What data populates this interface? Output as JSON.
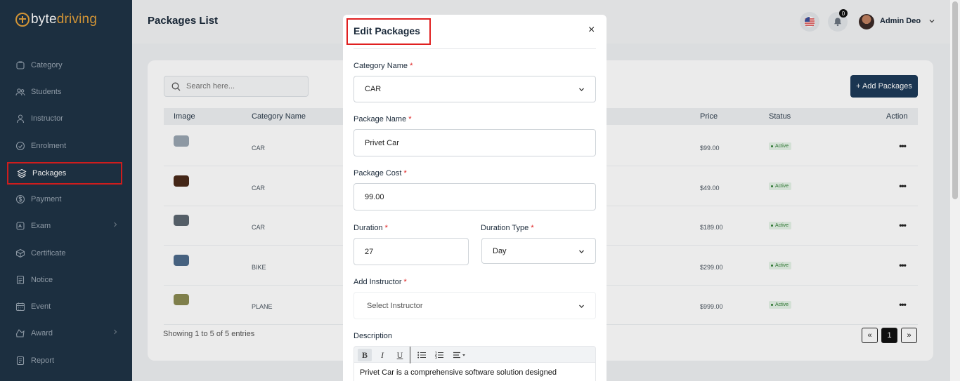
{
  "brand": {
    "part1": "byte",
    "part2": "driving",
    "accent": "#e3a13b"
  },
  "sidebar": {
    "items": [
      {
        "label": "Category",
        "icon": "category-icon",
        "top": 0
      },
      {
        "label": "Students",
        "icon": "students-icon"
      },
      {
        "label": "Instructor",
        "icon": "instructor-icon"
      },
      {
        "label": "Enrolment",
        "icon": "enrolment-icon"
      },
      {
        "label": "Packages",
        "icon": "packages-icon",
        "active": true
      },
      {
        "label": "Payment",
        "icon": "payment-icon"
      },
      {
        "label": "Exam",
        "icon": "exam-icon",
        "has_children": true
      },
      {
        "label": "Certificate",
        "icon": "certificate-icon"
      },
      {
        "label": "Notice",
        "icon": "notice-icon"
      },
      {
        "label": "Event",
        "icon": "event-icon"
      },
      {
        "label": "Award",
        "icon": "award-icon",
        "has_children": true
      },
      {
        "label": "Report",
        "icon": "report-icon"
      }
    ]
  },
  "header": {
    "title": "Packages List",
    "notifications_count": "0",
    "user_name": "Admin Deo",
    "flag_icon": "us-flag-icon",
    "bell_icon": "bell-icon"
  },
  "list": {
    "search_placeholder": "Search here...",
    "add_button": "+ Add Packages",
    "columns": [
      "Image",
      "Category Name",
      "Price",
      "Status",
      "Action"
    ],
    "rows": [
      {
        "category": "CAR",
        "price": "$99.00",
        "status": "Active",
        "thumb": "#9aa5b1"
      },
      {
        "category": "CAR",
        "price": "$49.00",
        "status": "Active",
        "thumb": "#4a2a1a"
      },
      {
        "category": "CAR",
        "price": "$189.00",
        "status": "Active",
        "thumb": "#5c6670"
      },
      {
        "category": "BIKE",
        "price": "$299.00",
        "status": "Active",
        "thumb": "#4d6a8a"
      },
      {
        "category": "PLANE",
        "price": "$999.00",
        "status": "Active",
        "thumb": "#8a8a52"
      }
    ],
    "action_label": "•••",
    "entries_text": "Showing 1 to 5 of 5 entries",
    "pagination": {
      "prev": "«",
      "current": "1",
      "next": "»"
    }
  },
  "modal": {
    "title": "Edit Packages",
    "close": "×",
    "category_label": "Category Name",
    "category_value": "CAR",
    "package_name_label": "Package Name",
    "package_name_value": "Privet Car",
    "package_cost_label": "Package Cost",
    "package_cost_value": "99.00",
    "duration_label": "Duration",
    "duration_value": "27",
    "duration_type_label": "Duration Type",
    "duration_type_value": "Day",
    "instructor_label": "Add Instructor",
    "instructor_placeholder": "Select Instructor",
    "description_label": "Description",
    "description_text": "Privet Car is a comprehensive software solution designed",
    "required_mark": "*",
    "toolbar": {
      "bold": "B",
      "italic": "I",
      "underline": "U"
    }
  }
}
